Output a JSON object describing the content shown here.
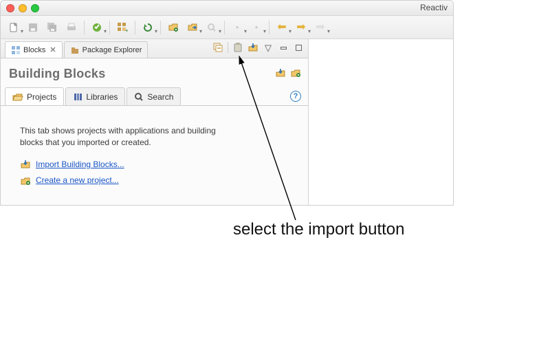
{
  "app": {
    "title": "Reactiv"
  },
  "panel": {
    "tabs": [
      {
        "label": "Blocks",
        "close": "✕"
      },
      {
        "label": "Package Explorer"
      }
    ],
    "heading": "Building Blocks",
    "subtabs": [
      {
        "label": "Projects"
      },
      {
        "label": "Libraries"
      },
      {
        "label": "Search"
      }
    ],
    "help_glyph": "?",
    "content": {
      "description": "This tab shows projects with applications and building blocks that you imported or created.",
      "import_link": "Import Building Blocks...",
      "newproject_link": "Create a new project..."
    }
  },
  "annotation": {
    "text": "select the import button"
  }
}
